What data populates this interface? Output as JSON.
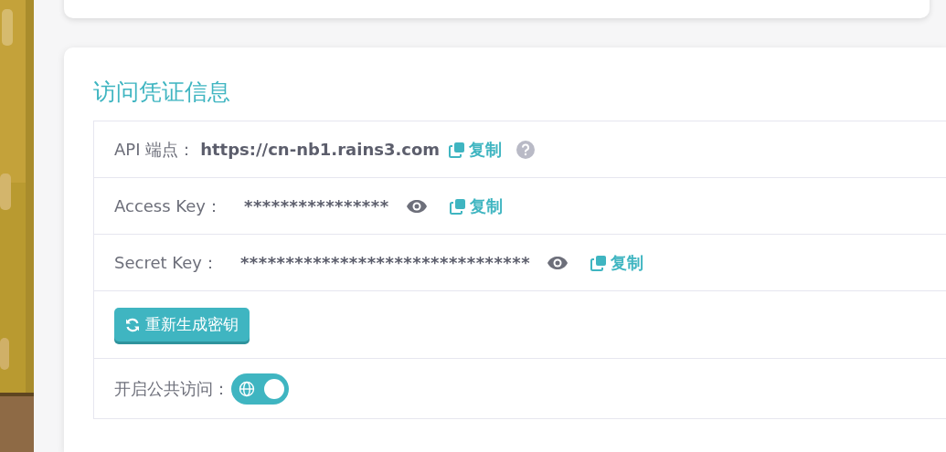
{
  "title": "访问凭证信息",
  "rows": [
    {
      "kind": "endpoint",
      "label": "API 端点：",
      "value": "https://cn-nb1.rains3.com",
      "copy": "复制"
    },
    {
      "kind": "secret",
      "label": "Access Key：",
      "value": "****************",
      "copy": "复制"
    },
    {
      "kind": "secret",
      "label": "Secret Key：",
      "value": "********************************",
      "copy": "复制"
    },
    {
      "kind": "button",
      "label": "重新生成密钥"
    },
    {
      "kind": "toggle",
      "label": "开启公共访问：",
      "on": true
    }
  ]
}
